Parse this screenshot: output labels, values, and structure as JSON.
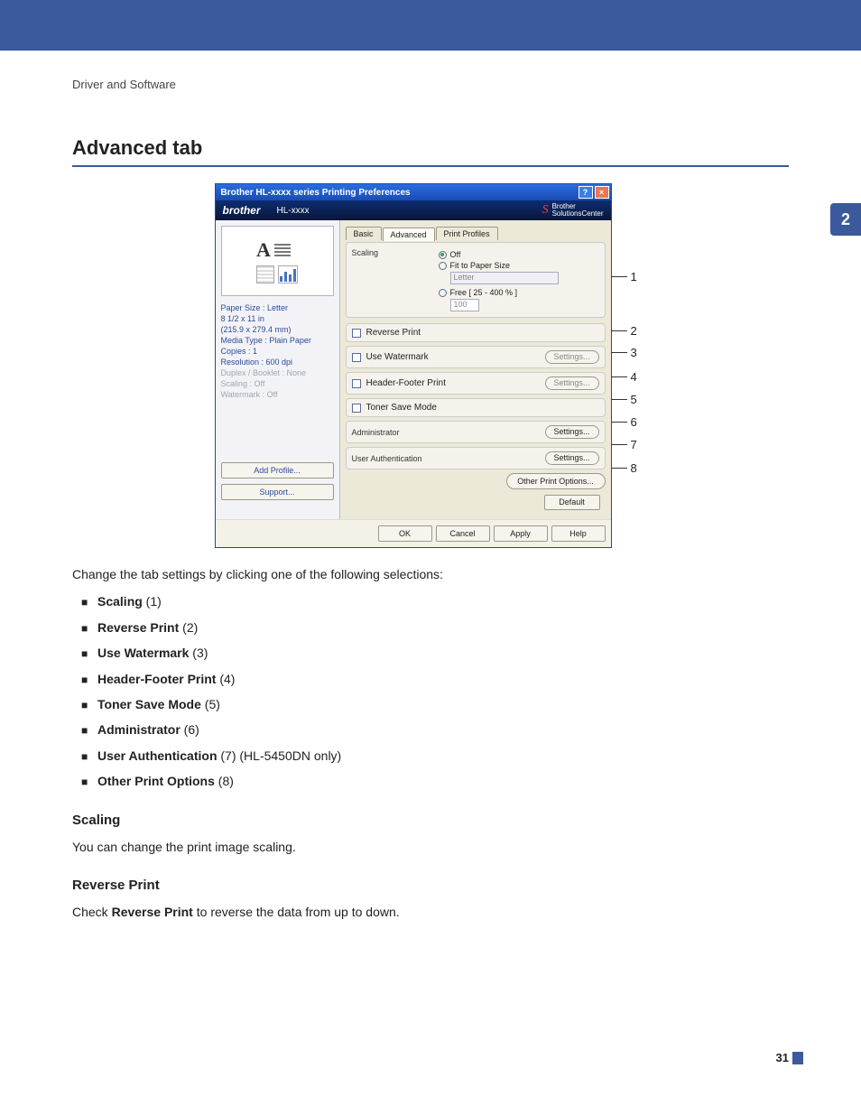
{
  "page": {
    "breadcrumb": "Driver and Software",
    "heading": "Advanced tab",
    "chapter": "2",
    "page_number": "31"
  },
  "dialog": {
    "title": "Brother HL-xxxx series Printing Preferences",
    "brand": "brother",
    "model": "HL-xxxx",
    "solutions": "Brother\nSolutionsCenter",
    "left": {
      "paper_size": "Paper Size : Letter",
      "dims_in": "8 1/2 x 11 in",
      "dims_mm": "(215.9 x 279.4 mm)",
      "media": "Media Type : Plain Paper",
      "copies": "Copies : 1",
      "res": "Resolution : 600 dpi",
      "duplex": "Duplex / Booklet : None",
      "scaling": "Scaling : Off",
      "watermark": "Watermark : Off",
      "add_profile": "Add Profile...",
      "support": "Support..."
    },
    "tabs": {
      "basic": "Basic",
      "advanced": "Advanced",
      "profiles": "Print Profiles"
    },
    "scaling": {
      "label": "Scaling",
      "off": "Off",
      "fit": "Fit to Paper Size",
      "fit_value": "Letter",
      "free": "Free [ 25 - 400 % ]",
      "free_value": "100"
    },
    "rows": {
      "reverse": "Reverse Print",
      "watermark": "Use Watermark",
      "header": "Header-Footer Print",
      "toner": "Toner Save Mode",
      "admin": "Administrator",
      "userauth": "User Authentication",
      "settings": "Settings...",
      "other": "Other Print Options..."
    },
    "footer": {
      "default": "Default",
      "ok": "OK",
      "cancel": "Cancel",
      "apply": "Apply",
      "help": "Help"
    }
  },
  "callouts": {
    "c1": "1",
    "c2": "2",
    "c3": "3",
    "c4": "4",
    "c5": "5",
    "c6": "6",
    "c7": "7",
    "c8": "8"
  },
  "intro": "Change the tab settings by clicking one of the following selections:",
  "items": [
    {
      "bold": "Scaling",
      "rest": " (1)"
    },
    {
      "bold": "Reverse Print",
      "rest": " (2)"
    },
    {
      "bold": "Use Watermark",
      "rest": " (3)"
    },
    {
      "bold": "Header-Footer Print",
      "rest": " (4)"
    },
    {
      "bold": "Toner Save Mode",
      "rest": " (5)"
    },
    {
      "bold": "Administrator",
      "rest": " (6)"
    },
    {
      "bold": "User Authentication",
      "rest": " (7) (HL-5450DN only)"
    },
    {
      "bold": "Other Print Options",
      "rest": " (8)"
    }
  ],
  "sections": {
    "scaling_h": "Scaling",
    "scaling_p": "You can change the print image scaling.",
    "reverse_h": "Reverse Print",
    "reverse_pre": "Check ",
    "reverse_bold": "Reverse Print",
    "reverse_post": " to reverse the data from up to down."
  }
}
